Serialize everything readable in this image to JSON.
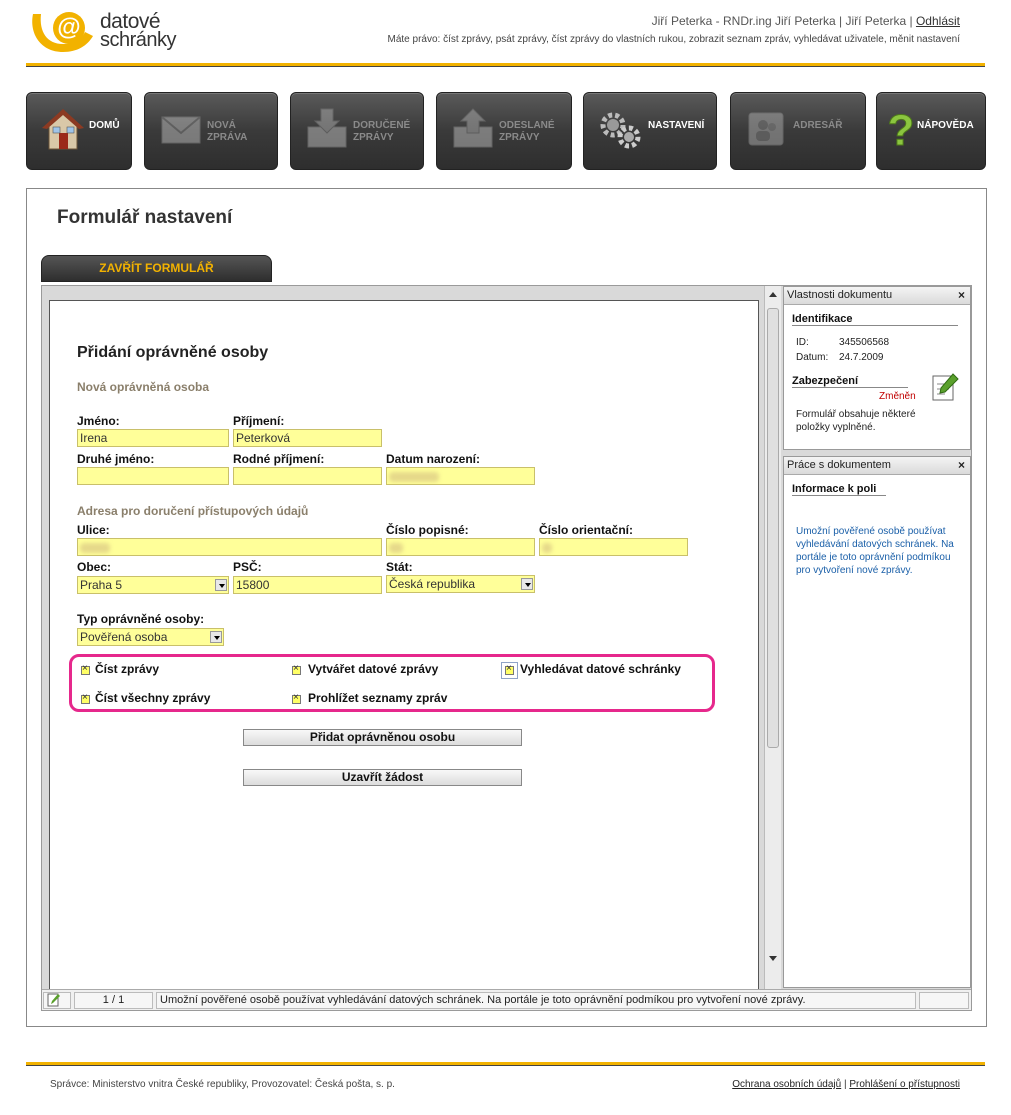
{
  "logo": {
    "line1": "datové",
    "line2": "schránky"
  },
  "header": {
    "user": "Jiří Peterka - RNDr.ing Jiří Peterka | Jiří Peterka |",
    "logout": "Odhlásit",
    "rights": "Máte právo: číst zprávy, psát zprávy, číst zprávy do vlastních rukou, zobrazit seznam zpráv, vyhledávat uživatele, měnit nastavení"
  },
  "nav": [
    {
      "id": "domu",
      "label1": "DOMŮ",
      "label2": "",
      "icon": "house-icon",
      "state": "active"
    },
    {
      "id": "nova",
      "label1": "NOVÁ",
      "label2": "ZPRÁVA",
      "icon": "envelope-icon",
      "state": "disabled"
    },
    {
      "id": "dorucene",
      "label1": "DORUČENÉ",
      "label2": "ZPRÁVY",
      "icon": "inbox-icon",
      "state": "disabled"
    },
    {
      "id": "odeslane",
      "label1": "ODESLANÉ",
      "label2": "ZPRÁVY",
      "icon": "outbox-icon",
      "state": "disabled"
    },
    {
      "id": "nastaveni",
      "label1": "NASTAVENÍ",
      "label2": "",
      "icon": "gears-icon",
      "state": "active"
    },
    {
      "id": "adresar",
      "label1": "ADRESÁŘ",
      "label2": "",
      "icon": "contacts-icon",
      "state": "disabled"
    },
    {
      "id": "napoveda",
      "label1": "NÁPOVĚDA",
      "label2": "",
      "icon": "question-icon",
      "state": "active"
    }
  ],
  "panel": {
    "title": "Formulář nastavení",
    "close_button": "ZAVŘÍT FORMULÁŘ"
  },
  "form": {
    "heading": "Přidání oprávněné osoby",
    "section_person": "Nová oprávněná osoba",
    "section_address": "Adresa pro doručení přístupových údajů",
    "labels": {
      "jmeno": "Jméno:",
      "prijmeni": "Příjmení:",
      "druhe": "Druhé jméno:",
      "rodne": "Rodné příjmení:",
      "datum": "Datum narození:",
      "ulice": "Ulice:",
      "cislo_pop": "Číslo popisné:",
      "cislo_or": "Číslo orientační:",
      "obec": "Obec:",
      "psc": "PSČ:",
      "stat": "Stát:",
      "typ": "Typ oprávněné osoby:"
    },
    "values": {
      "jmeno": "Irena",
      "prijmeni": "Peterková",
      "obec": "Praha 5",
      "psc": "15800",
      "stat": "Česká republika",
      "typ": "Pověřená osoba"
    },
    "permissions": [
      "Číst zprávy",
      "Vytvářet datové zprávy",
      "Vyhledávat datové schránky",
      "Číst všechny zprávy",
      "Prohlížet seznamy zpráv"
    ],
    "buttons": {
      "add": "Přidat oprávněnou osobu",
      "close": "Uzavřít žádost"
    }
  },
  "side_props": {
    "title": "Vlastnosti dokumentu",
    "identification": "Identifikace",
    "id_label": "ID:",
    "id_value": "345506568",
    "date_label": "Datum:",
    "date_value": "24.7.2009",
    "security": "Zabezpečení",
    "changed": "Změněn",
    "note": "Formulář obsahuje některé položky vyplněné."
  },
  "side_work": {
    "title": "Práce s dokumentem",
    "field_info": "Informace k poli",
    "help": "Umožní pověřené osobě používat vyhledávání datových schránek. Na portále je toto oprávnění podmíkou pro vytvoření nové zprávy."
  },
  "status": {
    "page": "1 / 1",
    "message": "Umožní pověřené osobě používat vyhledávání datových schránek. Na portále je toto oprávnění podmíkou pro vytvoření nové zprávy."
  },
  "footer": {
    "left": "Správce: Ministerstvo vnitra České republiky, Provozovatel: Česká pošta, s. p.",
    "link1": "Ochrana osobních údajů",
    "sep": "|",
    "link2": "Prohlášení o přístupnosti"
  },
  "colors": {
    "accent": "#f2b200",
    "highlight": "#e6288c",
    "field": "#ffff99",
    "help_text": "#1a5fa8"
  }
}
